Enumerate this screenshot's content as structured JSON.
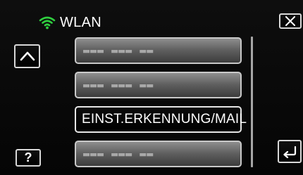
{
  "header": {
    "wifi_icon": "wifi-icon",
    "wifi_color": "#2fcf3f",
    "title": "WLAN"
  },
  "controls": {
    "close_icon": "close-icon",
    "up_icon": "chevron-up-icon",
    "help_label": "?",
    "back_icon": "return-icon"
  },
  "list": {
    "items": [
      {
        "label": "▬▬▬ ▬▬▬ ▬▬",
        "masked": true
      },
      {
        "label": "▬▬▬ ▬▬▬ ▬▬",
        "masked": true
      },
      {
        "label": "EINST.ERKENNUNG/MAIL",
        "masked": false
      },
      {
        "label": "▬▬▬ ▬▬▬ ▬▬",
        "masked": true
      }
    ]
  }
}
